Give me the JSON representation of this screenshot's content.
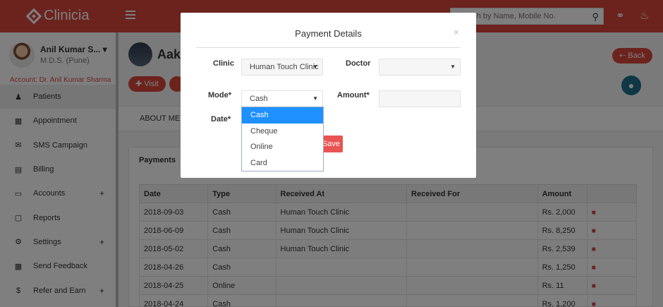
{
  "header": {
    "logo": "Clinicia",
    "search_placeholder": "Search by Name, Mobile No."
  },
  "sidebar": {
    "user_name": "Anil Kumar S... ▾",
    "user_degree": "M.D.S. (Pune)",
    "account": "Account: Dr. Anil Kumar Sharma",
    "items": [
      {
        "label": "Patients",
        "icon": "users-icon",
        "plus": ""
      },
      {
        "label": "Appointment",
        "icon": "calendar-icon",
        "plus": ""
      },
      {
        "label": "SMS Campaign",
        "icon": "envelope-icon",
        "plus": ""
      },
      {
        "label": "Billing",
        "icon": "clipboard-icon",
        "plus": ""
      },
      {
        "label": "Accounts",
        "icon": "card-icon",
        "plus": "+"
      },
      {
        "label": "Reports",
        "icon": "report-icon",
        "plus": ""
      },
      {
        "label": "Settings",
        "icon": "gear-icon",
        "plus": "+"
      },
      {
        "label": "Send Feedback",
        "icon": "comment-icon",
        "plus": ""
      },
      {
        "label": "Refer and Earn",
        "icon": "dollar-icon",
        "plus": "+"
      }
    ]
  },
  "main": {
    "patient_name": "Aakr",
    "visit_button": "✚ Visit",
    "back_button": "⇠ Back",
    "tab_about": "ABOUT ME",
    "panel_title": "Payments",
    "columns": [
      "Date",
      "Type",
      "Received At",
      "Received For",
      "Amount",
      ""
    ],
    "rows": [
      {
        "date": "2018-09-03",
        "type": "Cash",
        "received_at": "Human Touch Clinic",
        "received_for": "",
        "amount": "Rs. 2,000"
      },
      {
        "date": "2018-06-09",
        "type": "Cash",
        "received_at": "Human Touch Clinic",
        "received_for": "",
        "amount": "Rs. 8,250"
      },
      {
        "date": "2018-05-02",
        "type": "Cash",
        "received_at": "Human Touch Clinic",
        "received_for": "",
        "amount": "Rs. 2,539"
      },
      {
        "date": "2018-04-26",
        "type": "Cash",
        "received_at": "",
        "received_for": "",
        "amount": "Rs. 1,250"
      },
      {
        "date": "2018-04-25",
        "type": "Online",
        "received_at": "",
        "received_for": "",
        "amount": "Rs. 11"
      },
      {
        "date": "2018-04-24",
        "type": "Cash",
        "received_at": "",
        "received_for": "",
        "amount": "Rs. 1,200"
      }
    ]
  },
  "modal": {
    "title": "Payment Details",
    "close": "×",
    "clinic_label": "Clinic",
    "clinic_value": "Human Touch Clinic",
    "doctor_label": "Doctor",
    "doctor_value": "",
    "mode_label": "Mode*",
    "mode_value": "Cash",
    "amount_label": "Amount*",
    "amount_value": "",
    "date_label": "Date*",
    "save_label": "Save",
    "mode_options": [
      "Cash",
      "Cheque",
      "Online",
      "Card"
    ],
    "selected_option": "Cash"
  }
}
